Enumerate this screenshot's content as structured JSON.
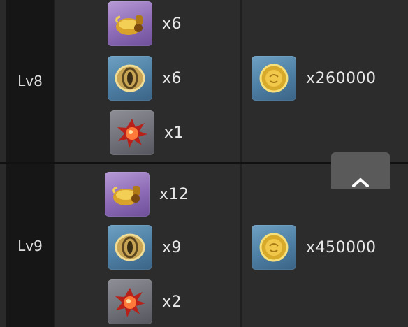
{
  "rows": [
    {
      "level": "Lv8",
      "materials": [
        {
          "icon": "golden-vessel-icon",
          "quantity": "x6"
        },
        {
          "icon": "bronze-ring-icon",
          "quantity": "x6"
        },
        {
          "icon": "red-crystal-icon",
          "quantity": "x1"
        }
      ],
      "coin": {
        "icon": "gold-coin-icon",
        "quantity": "x260000"
      }
    },
    {
      "level": "Lv9",
      "materials": [
        {
          "icon": "golden-vessel-icon",
          "quantity": "x12"
        },
        {
          "icon": "bronze-ring-icon",
          "quantity": "x9"
        },
        {
          "icon": "red-crystal-icon",
          "quantity": "x2"
        }
      ],
      "coin": {
        "icon": "gold-coin-icon",
        "quantity": "x450000"
      }
    }
  ],
  "scroll_top_button": {
    "icon": "chevron-up-icon"
  },
  "colors": {
    "level_bg": "#161616",
    "cell_bg": "#2c2c2c",
    "rarity_purple": "#8d6bb6",
    "rarity_blue": "#4d7ea3",
    "rarity_gray": "#6f7078"
  }
}
